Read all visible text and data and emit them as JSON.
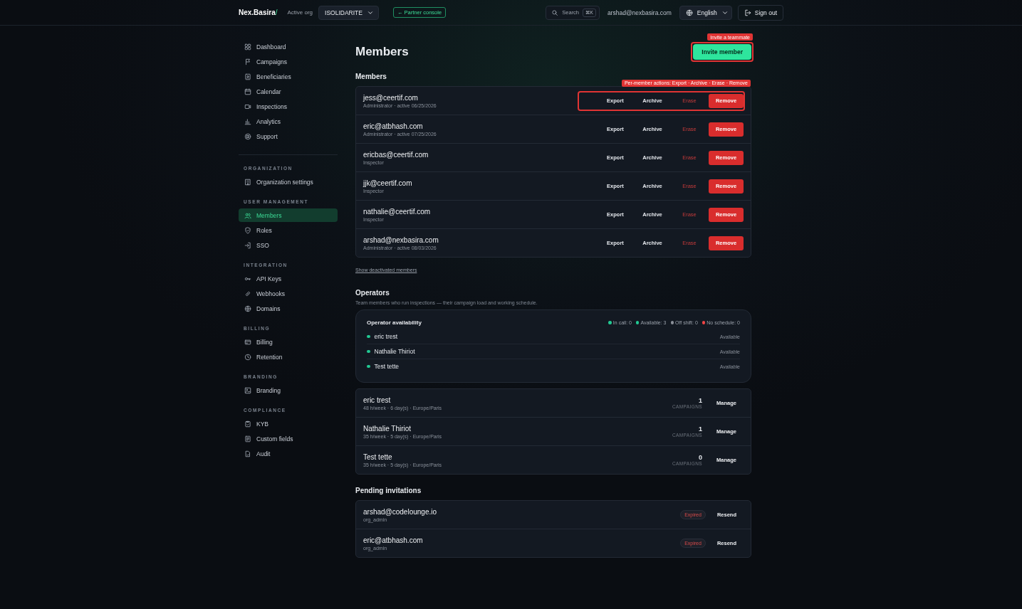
{
  "header": {
    "logo": {
      "name": "Nex.Basira",
      "mark": "/"
    },
    "org_label": "Active org",
    "org_select": "ISOLIDARITE",
    "partner_button": "← Partner console",
    "search": {
      "label": "Search",
      "shortcut": "⌘K"
    },
    "user_email": "arshad@nexbasira.com",
    "language": "English",
    "sign_out": "Sign out"
  },
  "sidebar": {
    "groups": [
      {
        "items": [
          {
            "label": "Dashboard",
            "selected": false
          },
          {
            "label": "Campaigns",
            "selected": false
          },
          {
            "label": "Beneficiaries",
            "selected": false
          },
          {
            "label": "Calendar",
            "selected": false
          },
          {
            "label": "Inspections",
            "selected": false
          },
          {
            "label": "Analytics",
            "selected": false
          },
          {
            "label": "Support",
            "selected": false
          }
        ]
      },
      {
        "title": "ORGANIZATION",
        "items": [
          {
            "label": "Organization settings",
            "selected": false
          }
        ]
      },
      {
        "title": "USER MANAGEMENT",
        "items": [
          {
            "label": "Members",
            "selected": true
          },
          {
            "label": "Roles",
            "selected": false
          },
          {
            "label": "SSO",
            "selected": false
          }
        ]
      },
      {
        "title": "INTEGRATION",
        "items": [
          {
            "label": "API Keys",
            "selected": false
          },
          {
            "label": "Webhooks",
            "selected": false
          },
          {
            "label": "Domains",
            "selected": false
          }
        ]
      },
      {
        "title": "BILLING",
        "items": [
          {
            "label": "Billing",
            "selected": false
          },
          {
            "label": "Retention",
            "selected": false
          }
        ]
      },
      {
        "title": "BRANDING",
        "items": [
          {
            "label": "Branding",
            "selected": false
          }
        ]
      },
      {
        "title": "COMPLIANCE",
        "items": [
          {
            "label": "KYB",
            "selected": false
          },
          {
            "label": "Custom fields",
            "selected": false
          },
          {
            "label": "Audit",
            "selected": false
          }
        ]
      }
    ]
  },
  "page": {
    "title": "Members",
    "invite_button": "Invite member",
    "invite_annotation": "Invite a teammate",
    "actions_annotation": "Per-member actions: Export · Archive · Erase · Remove"
  },
  "members": {
    "title": "Members",
    "rows": [
      {
        "email": "jess@ceertif.com",
        "meta": "Administrator  · active 06/25/2026",
        "highlighted": true,
        "actions": [
          {
            "label": "Export",
            "kind": "plain"
          },
          {
            "label": "Archive",
            "kind": "plain"
          },
          {
            "label": "Erase",
            "kind": "danger-text"
          },
          {
            "label": "Remove",
            "kind": "danger"
          }
        ]
      },
      {
        "email": "eric@atbhash.com",
        "meta": "Administrator  · active 07/25/2026",
        "highlighted": false,
        "actions": [
          {
            "label": "Export",
            "kind": "plain"
          },
          {
            "label": "Archive",
            "kind": "plain"
          },
          {
            "label": "Erase",
            "kind": "danger-text"
          },
          {
            "label": "Remove",
            "kind": "danger"
          }
        ]
      },
      {
        "email": "ericbas@ceertif.com",
        "meta": "Inspector",
        "highlighted": false,
        "actions": [
          {
            "label": "Export",
            "kind": "plain"
          },
          {
            "label": "Archive",
            "kind": "plain"
          },
          {
            "label": "Erase",
            "kind": "danger-text"
          },
          {
            "label": "Remove",
            "kind": "danger"
          }
        ]
      },
      {
        "email": "jjk@ceertif.com",
        "meta": "Inspector",
        "highlighted": false,
        "actions": [
          {
            "label": "Export",
            "kind": "plain"
          },
          {
            "label": "Archive",
            "kind": "plain"
          },
          {
            "label": "Erase",
            "kind": "danger-text"
          },
          {
            "label": "Remove",
            "kind": "danger"
          }
        ]
      },
      {
        "email": "nathalie@ceertif.com",
        "meta": "Inspector",
        "highlighted": false,
        "actions": [
          {
            "label": "Export",
            "kind": "plain"
          },
          {
            "label": "Archive",
            "kind": "plain"
          },
          {
            "label": "Erase",
            "kind": "danger-text"
          },
          {
            "label": "Remove",
            "kind": "danger"
          }
        ]
      },
      {
        "email": "arshad@nexbasira.com",
        "meta": "Administrator  · active 08/03/2026",
        "highlighted": false,
        "actions": [
          {
            "label": "Export",
            "kind": "plain"
          },
          {
            "label": "Archive",
            "kind": "plain"
          },
          {
            "label": "Erase",
            "kind": "danger-text"
          },
          {
            "label": "Remove",
            "kind": "danger"
          }
        ]
      }
    ],
    "show_deactivated": "Show deactivated members"
  },
  "operators": {
    "title": "Operators",
    "subtitle": "Team members who run inspections — their campaign load and working schedule.",
    "availability": {
      "title": "Operator availability",
      "legend": [
        {
          "label": "In call: 0",
          "color": "#22c993"
        },
        {
          "label": "Available: 3",
          "color": "#22c993"
        },
        {
          "label": "Off shift: 0",
          "color": "#8a8f98"
        },
        {
          "label": "No schedule: 0",
          "color": "#ef4444"
        }
      ],
      "people": [
        {
          "name": "eric trest",
          "status": "Available",
          "color": "#22c993"
        },
        {
          "name": "Nathalie Thiriot",
          "status": "Available",
          "color": "#22c993"
        },
        {
          "name": "Test tette",
          "status": "Available",
          "color": "#22c993"
        }
      ]
    },
    "cards": [
      {
        "name": "eric trest",
        "details": "48 h/week · 6 day(s) · Europe/Paris",
        "count": "1",
        "count_label": "CAMPAIGNS",
        "action": "Manage"
      },
      {
        "name": "Nathalie Thiriot",
        "details": "35 h/week · 5 day(s) · Europe/Paris",
        "count": "1",
        "count_label": "CAMPAIGNS",
        "action": "Manage"
      },
      {
        "name": "Test tette",
        "details": "35 h/week · 5 day(s) · Europe/Paris",
        "count": "0",
        "count_label": "CAMPAIGNS",
        "action": "Manage"
      }
    ]
  },
  "invitations": {
    "title": "Pending invitations",
    "rows": [
      {
        "email": "arshad@codelounge.io",
        "role": "org_admin",
        "status": "Expired",
        "action": "Resend"
      },
      {
        "email": "eric@atbhash.com",
        "role": "org_admin",
        "status": "Expired",
        "action": "Resend"
      }
    ]
  }
}
